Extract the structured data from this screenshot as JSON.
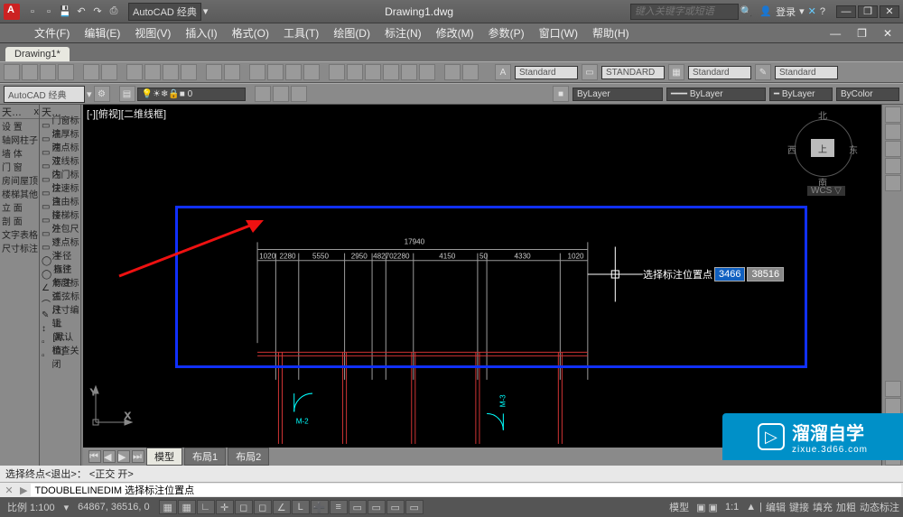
{
  "titlebar": {
    "workspace": "AutoCAD 经典",
    "doc": "Drawing1.dwg",
    "search_placeholder": "键入关键字或短语",
    "login": "登录"
  },
  "menubar": {
    "items": [
      "文件(F)",
      "编辑(E)",
      "视图(V)",
      "插入(I)",
      "格式(O)",
      "工具(T)",
      "绘图(D)",
      "标注(N)",
      "修改(M)",
      "参数(P)",
      "窗口(W)",
      "帮助(H)"
    ]
  },
  "filetab": {
    "name": "Drawing1*"
  },
  "propbar": {
    "workspace": "AutoCAD 经典",
    "layerstate": "0",
    "text_style_label": "Standard",
    "dim_style_label": "STANDARD",
    "table_style_label": "Standard",
    "ml_style_label": "Standard"
  },
  "layerbar": {
    "layer_combo": "ByLayer",
    "color_combo": "ByLayer",
    "ltype_combo": "ByLayer",
    "lweight_combo": "ByColor"
  },
  "leftpanel1": {
    "title": "天…",
    "close": "x",
    "items": [
      "设   置",
      "轴网柱子",
      "墙   体",
      "门   窗",
      "房间屋顶",
      "楼梯其他",
      "立   面",
      "剖   面",
      "文字表格",
      "尺寸标注"
    ]
  },
  "leftpanel2": {
    "title": "天…",
    "items": [
      "门窗标注",
      "墙厚标注",
      "两点标注",
      "双线标注",
      "内门标注",
      "快速标注",
      "自由标注",
      "楼梯标注",
      "外包尺寸",
      "逐点标注",
      "半径标注",
      "直径标注",
      "角度标注",
      "弧弦标注",
      "尺寸编辑",
      "上 调…",
      "[默认值]",
      "检查关闭"
    ]
  },
  "canvas": {
    "view_label": "[-][俯视][二维线框]",
    "compass": {
      "n": "北",
      "s": "南",
      "e": "东",
      "w": "西",
      "top": "上",
      "wcs": "WCS ▽"
    },
    "dim_total": "17940",
    "dim_segments": [
      "1020",
      "2280",
      "5550",
      "2950",
      "48270",
      "2280",
      "4150",
      "50",
      "4330",
      "1020"
    ],
    "marks": {
      "m2": "M-2",
      "m3_v": "M-3"
    },
    "dyninput": {
      "prompt": "选择标注位置点",
      "val1": "3466",
      "val2": "38516"
    },
    "ucs": {
      "x": "X",
      "y": "Y"
    }
  },
  "modeltabs": {
    "model": "模型",
    "layout1": "布局1",
    "layout2": "布局2"
  },
  "cmd": {
    "history": "选择终点<退出>：  <正交 开>",
    "prompt_icon": "▶",
    "prompt": "TDOUBLELINEDIM 选择标注位置点"
  },
  "status": {
    "scale": "比例 1:100",
    "coords": "64867, 36516, 0",
    "right": {
      "model": "模型",
      "annoscale": "1:1",
      "vis": "▲",
      "tools": [
        "编辑",
        "键接",
        "填充",
        "加粗",
        "动态标注"
      ]
    }
  },
  "watermark": {
    "brand": "溜溜自学",
    "site": "zixue.3d66.com"
  }
}
